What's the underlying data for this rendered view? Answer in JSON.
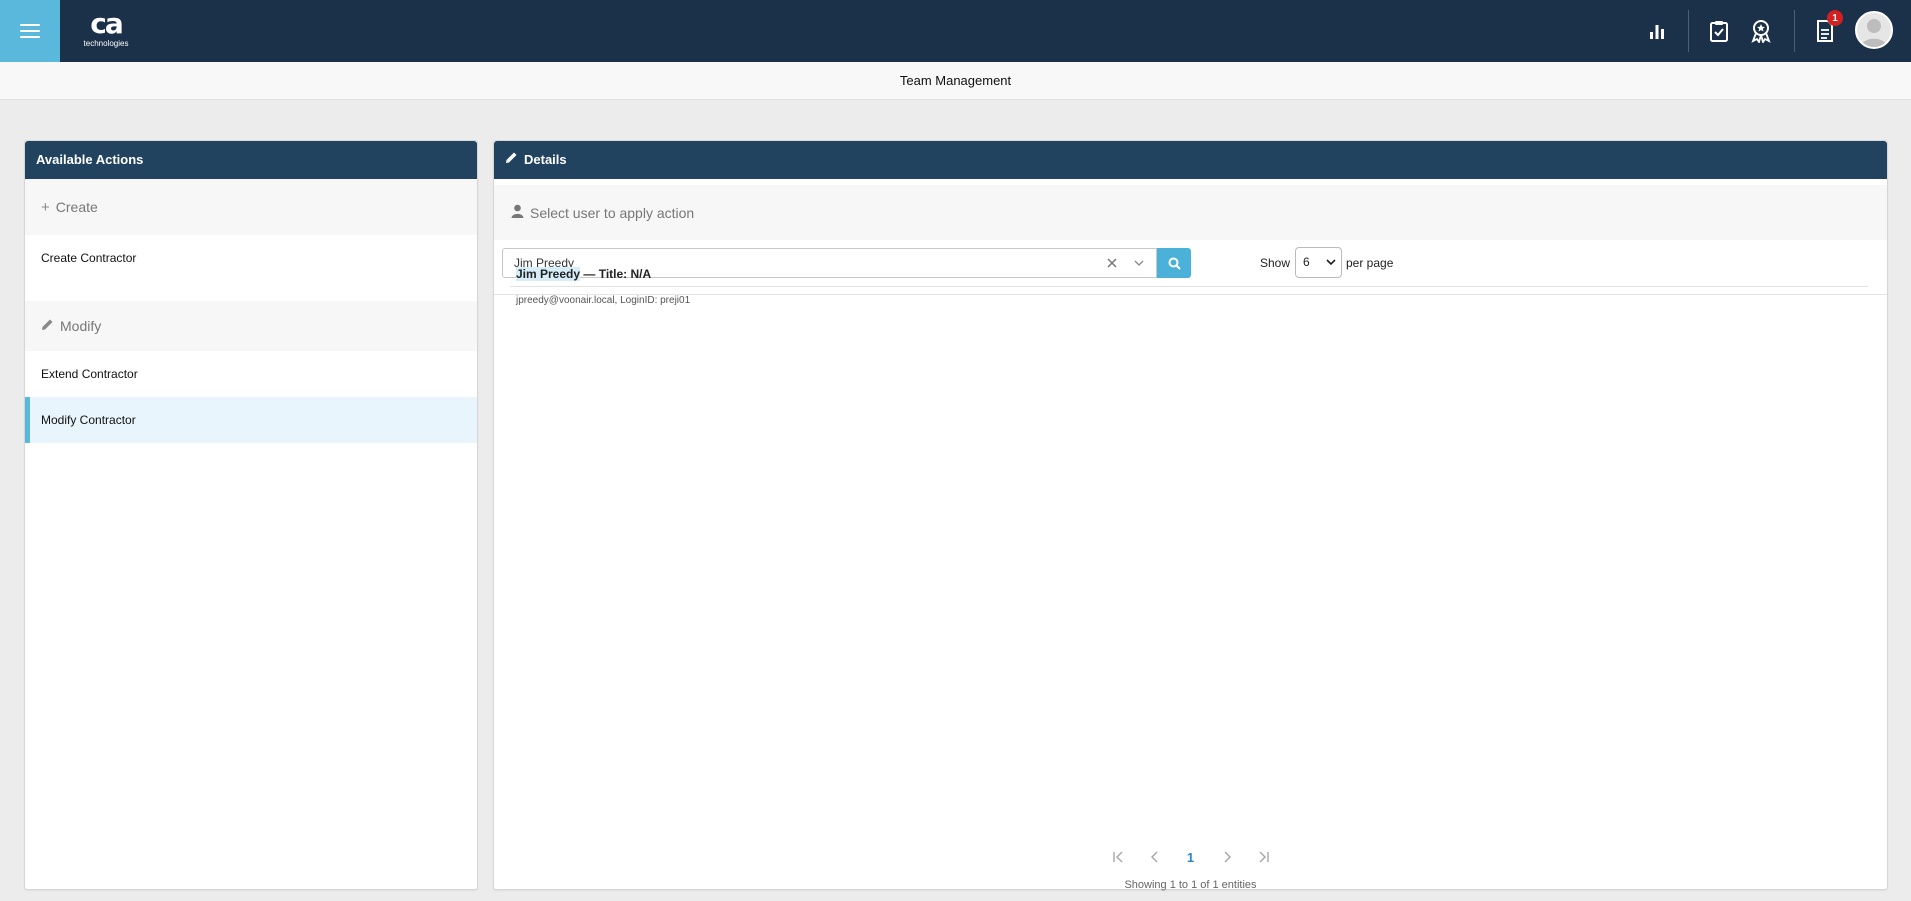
{
  "header": {
    "logo_main": "ca",
    "logo_sub": "technologies",
    "icons": [
      "bar-chart-icon",
      "clipboard-check-icon",
      "award-badge-icon",
      "document-icon",
      "user-avatar-icon"
    ],
    "notification_count": "1"
  },
  "subheader": {
    "title": "Team Management"
  },
  "left_panel": {
    "title": "Available Actions",
    "sections": [
      {
        "label": "Create",
        "icon": "plus-icon",
        "items": [
          "Create Contractor"
        ]
      },
      {
        "label": "Modify",
        "icon": "pencil-icon",
        "items": [
          "Extend Contractor",
          "Modify Contractor"
        ]
      }
    ],
    "selected_item": "Modify Contractor"
  },
  "right_panel": {
    "title": "Details",
    "select_user_label": "Select user to apply action",
    "search": {
      "value": "Jim Preedy"
    },
    "show_label": "Show",
    "per_page_value": "6",
    "per_page_label": "per page",
    "result": {
      "name": "Jim Preedy",
      "title_suffix": " — Title: N/A",
      "subtitle": "jpreedy@voonair.local, LoginID: preji01"
    },
    "pager": {
      "current": "1"
    },
    "showing_text": "Showing 1 to 1 of 1 entities"
  },
  "colors": {
    "topbar": "#1b3049",
    "menu_accent": "#5bb8dd",
    "panel_header": "#21435f",
    "search_button": "#4cb1d8",
    "badge": "#d32020"
  }
}
